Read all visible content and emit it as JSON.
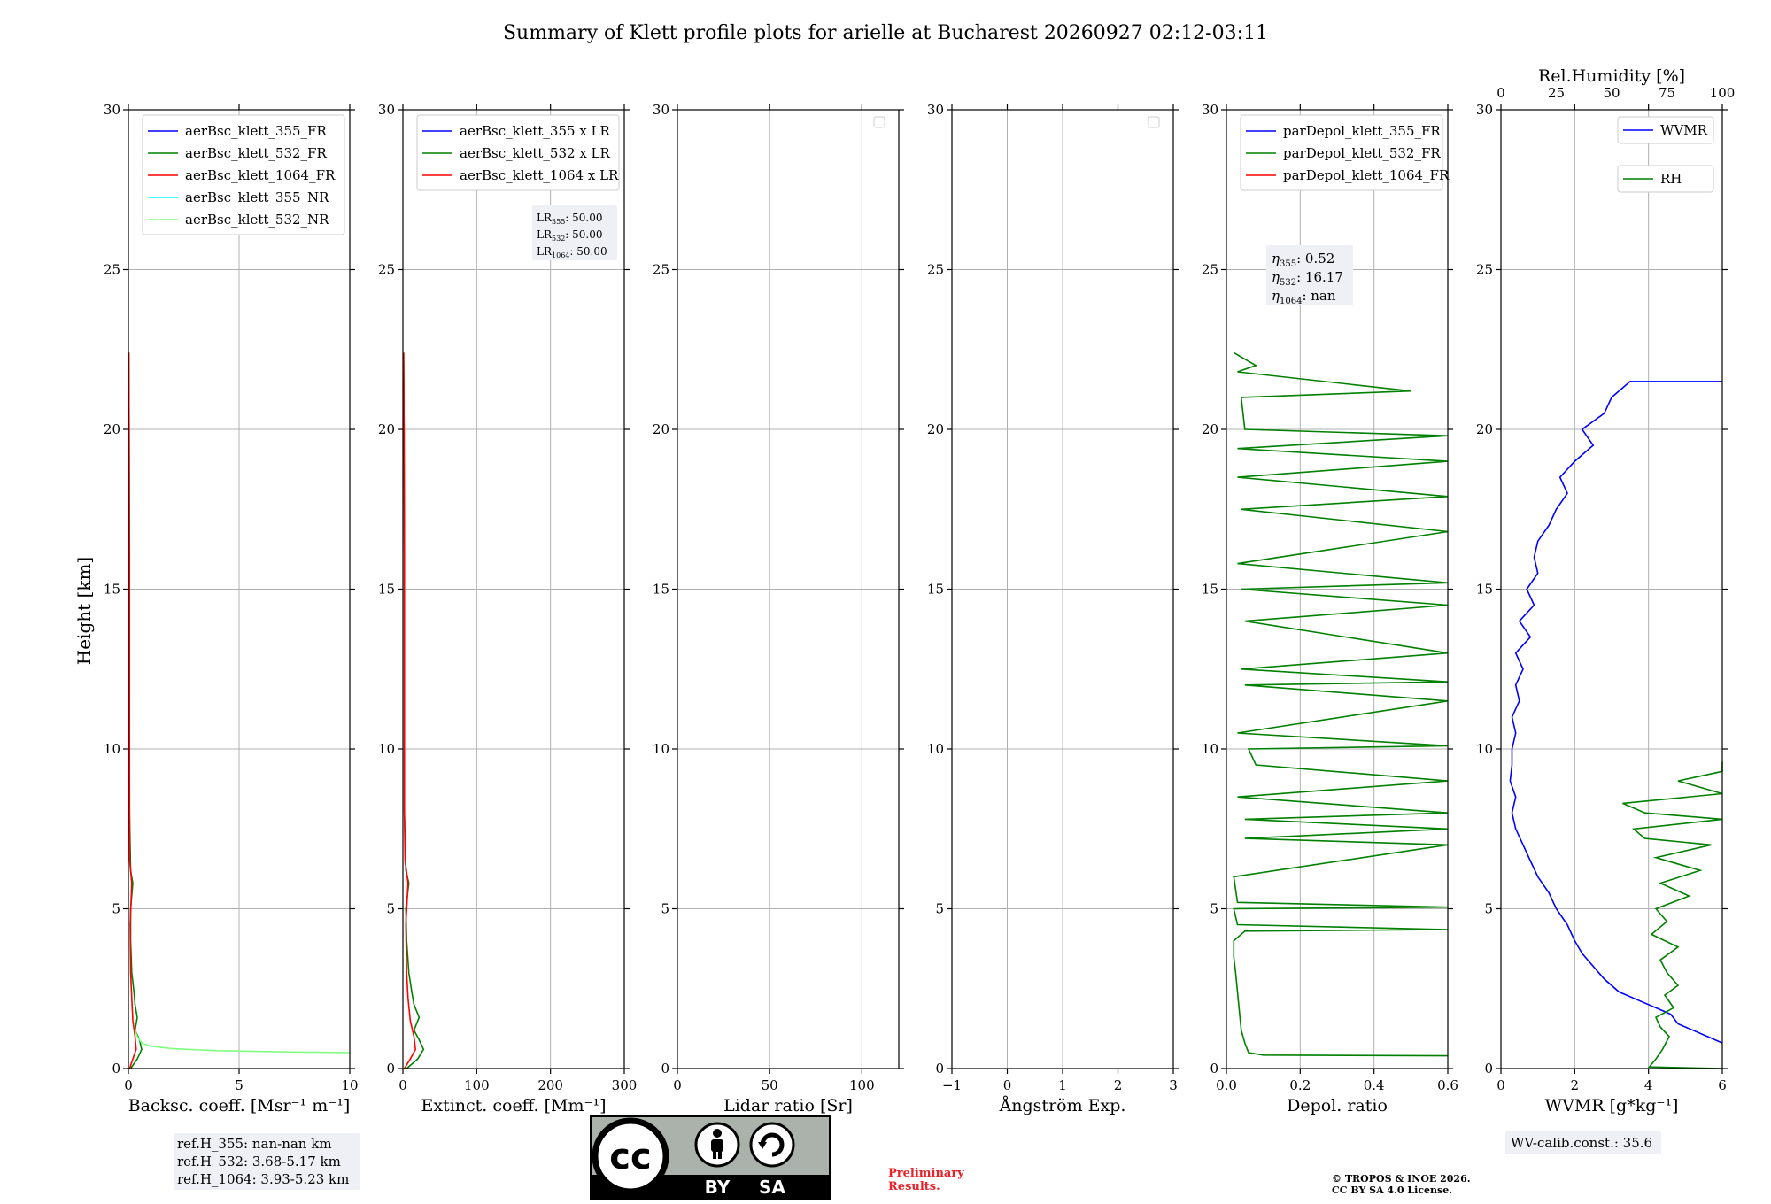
{
  "title": "Summary of Klett profile plots for arielle at Bucharest 20260927 02:12-03:11",
  "height_label": "Height [km]",
  "ref_heights": [
    "ref.H_355: nan-nan km",
    "ref.H_532: 3.68-5.17 km",
    "ref.H_1064: 3.93-5.23 km"
  ],
  "wv_calib": "WV-calib.const.: 35.6",
  "license_badge": {
    "by": "BY",
    "sa": "SA",
    "cc": "cc"
  },
  "preliminary": [
    "Preliminary",
    "Results."
  ],
  "copyright": [
    "© TROPOS & INOE 2026.",
    "CC BY SA 4.0 License."
  ],
  "colors": {
    "blue": "#0000ff",
    "green": "#008000",
    "red": "#ff0000",
    "cyan": "#00ffff",
    "lightgreen": "#80ff80",
    "grid": "#b0b0b0"
  },
  "chart_data": [
    {
      "type": "line",
      "xlabel": "Backsc. coeff. [Msr⁻¹ m⁻¹]",
      "ylabel": "Height [km]",
      "xlim": [
        0,
        10
      ],
      "ylim": [
        0,
        30
      ],
      "xticks": [
        0,
        5,
        10
      ],
      "yticks": [
        0,
        5,
        10,
        15,
        20,
        25,
        30
      ],
      "grid": true,
      "legend_position": "top-right",
      "series": [
        {
          "name": "aerBsc_klett_355_FR",
          "color": "#0000ff",
          "points": []
        },
        {
          "name": "aerBsc_klett_532_FR",
          "color": "#008000",
          "points": [
            [
              0.1,
              0
            ],
            [
              0.4,
              0.3
            ],
            [
              0.6,
              0.6
            ],
            [
              0.5,
              0.9
            ],
            [
              0.3,
              1.2
            ],
            [
              0.4,
              1.6
            ],
            [
              0.3,
              2.0
            ],
            [
              0.25,
              2.4
            ],
            [
              0.15,
              3.0
            ],
            [
              0.1,
              4.0
            ],
            [
              0.1,
              5.0
            ],
            [
              0.2,
              5.8
            ],
            [
              0.1,
              6.2
            ],
            [
              0.05,
              8
            ],
            [
              0.05,
              12
            ],
            [
              0.05,
              16
            ],
            [
              0.03,
              20
            ],
            [
              0.02,
              22.4
            ]
          ]
        },
        {
          "name": "aerBsc_klett_1064_FR",
          "color": "#ff0000",
          "points": [
            [
              0.05,
              0
            ],
            [
              0.2,
              0.3
            ],
            [
              0.35,
              0.6
            ],
            [
              0.3,
              1.0
            ],
            [
              0.2,
              1.5
            ],
            [
              0.15,
              2.2
            ],
            [
              0.1,
              3.0
            ],
            [
              0.08,
              4.5
            ],
            [
              0.15,
              5.8
            ],
            [
              0.06,
              6.5
            ],
            [
              0.05,
              8
            ],
            [
              0.04,
              12
            ],
            [
              0.04,
              16
            ],
            [
              0.03,
              20
            ],
            [
              0.02,
              22.4
            ]
          ]
        },
        {
          "name": "aerBsc_klett_355_NR",
          "color": "#00ffff",
          "points": []
        },
        {
          "name": "aerBsc_klett_532_NR",
          "color": "#80ff80",
          "points": [
            [
              10,
              0.5
            ],
            [
              7,
              0.52
            ],
            [
              4,
              0.56
            ],
            [
              2,
              0.62
            ],
            [
              1,
              0.7
            ],
            [
              0.6,
              0.8
            ],
            [
              0.4,
              1.0
            ],
            [
              0.3,
              1.2
            ]
          ]
        }
      ],
      "annotation": []
    },
    {
      "type": "line",
      "xlabel": "Extinct. coeff. [Mm⁻¹]",
      "xlim": [
        0,
        300
      ],
      "ylim": [
        0,
        30
      ],
      "xticks": [
        0,
        100,
        200,
        300
      ],
      "yticks": [
        0,
        5,
        10,
        15,
        20,
        25,
        30
      ],
      "grid": true,
      "legend_position": "top-right",
      "series": [
        {
          "name": "aerBsc_klett_355 x LR",
          "color": "#0000ff",
          "points": []
        },
        {
          "name": "aerBsc_klett_532 x LR",
          "color": "#008000",
          "points": [
            [
              5,
              0
            ],
            [
              20,
              0.3
            ],
            [
              28,
              0.6
            ],
            [
              22,
              0.9
            ],
            [
              15,
              1.2
            ],
            [
              22,
              1.6
            ],
            [
              15,
              2.0
            ],
            [
              12,
              2.4
            ],
            [
              8,
              3.0
            ],
            [
              5,
              4.0
            ],
            [
              4,
              5.0
            ],
            [
              8,
              5.8
            ],
            [
              4,
              6.2
            ],
            [
              2,
              8
            ],
            [
              2,
              12
            ],
            [
              2,
              16
            ],
            [
              1.5,
              20
            ],
            [
              1,
              22.4
            ]
          ]
        },
        {
          "name": "aerBsc_klett_1064 x LR",
          "color": "#ff0000",
          "points": [
            [
              2,
              0
            ],
            [
              10,
              0.3
            ],
            [
              17,
              0.6
            ],
            [
              15,
              1.0
            ],
            [
              10,
              1.5
            ],
            [
              7,
              2.2
            ],
            [
              5,
              3.0
            ],
            [
              4,
              4.5
            ],
            [
              7,
              5.8
            ],
            [
              3,
              6.5
            ],
            [
              2,
              8
            ],
            [
              2,
              12
            ],
            [
              2,
              16
            ],
            [
              1.5,
              20
            ],
            [
              1,
              22.4
            ]
          ]
        }
      ],
      "annotation": {
        "lr355": "50.00",
        "lr532": "50.00",
        "lr1064": "50.00"
      }
    },
    {
      "type": "line",
      "xlabel": "Lidar ratio [Sr]",
      "xlim": [
        0,
        120
      ],
      "ylim": [
        0,
        30
      ],
      "xticks": [
        0,
        50,
        100
      ],
      "yticks": [
        0,
        5,
        10,
        15,
        20,
        25,
        30
      ],
      "grid": true,
      "legend_position": "top-right",
      "series": []
    },
    {
      "type": "line",
      "xlabel": "Ångström Exp.",
      "xlim": [
        -1,
        3
      ],
      "ylim": [
        0,
        30
      ],
      "xticks": [
        -1,
        0,
        1,
        2,
        3
      ],
      "yticks": [
        0,
        5,
        10,
        15,
        20,
        25,
        30
      ],
      "grid": true,
      "legend_position": "top-right",
      "series": []
    },
    {
      "type": "line",
      "xlabel": "Depol. ratio",
      "xlim": [
        0,
        0.6
      ],
      "ylim": [
        0,
        30
      ],
      "xticks": [
        0.0,
        0.2,
        0.4,
        0.6
      ],
      "yticks": [
        0,
        5,
        10,
        15,
        20,
        25,
        30
      ],
      "grid": true,
      "legend_position": "top-right",
      "series": [
        {
          "name": "parDepol_klett_355_FR",
          "color": "#0000ff",
          "points": []
        },
        {
          "name": "parDepol_klett_532_FR",
          "color": "#008000",
          "points": [
            [
              0.6,
              0.4
            ],
            [
              0.1,
              0.42
            ],
            [
              0.06,
              0.5
            ],
            [
              0.05,
              0.8
            ],
            [
              0.04,
              1.2
            ],
            [
              0.035,
              1.8
            ],
            [
              0.03,
              2.4
            ],
            [
              0.025,
              3.0
            ],
            [
              0.02,
              3.5
            ],
            [
              0.02,
              4.0
            ],
            [
              0.05,
              4.3
            ],
            [
              0.6,
              4.35
            ],
            [
              0.03,
              4.5
            ],
            [
              0.02,
              5.0
            ],
            [
              0.6,
              5.05
            ],
            [
              0.03,
              5.2
            ],
            [
              0.02,
              6.0
            ],
            [
              0.6,
              7.0
            ],
            [
              0.05,
              7.2
            ],
            [
              0.6,
              7.5
            ],
            [
              0.05,
              7.8
            ],
            [
              0.6,
              8.0
            ],
            [
              0.03,
              8.5
            ],
            [
              0.6,
              9.0
            ],
            [
              0.08,
              9.5
            ],
            [
              0.06,
              10.0
            ],
            [
              0.6,
              10.1
            ],
            [
              0.03,
              10.5
            ],
            [
              0.6,
              11.5
            ],
            [
              0.05,
              12.0
            ],
            [
              0.6,
              12.1
            ],
            [
              0.04,
              12.5
            ],
            [
              0.6,
              13.0
            ],
            [
              0.05,
              14.0
            ],
            [
              0.6,
              14.5
            ],
            [
              0.04,
              15.0
            ],
            [
              0.6,
              15.2
            ],
            [
              0.03,
              15.8
            ],
            [
              0.6,
              16.8
            ],
            [
              0.04,
              17.5
            ],
            [
              0.6,
              17.9
            ],
            [
              0.03,
              18.5
            ],
            [
              0.6,
              19.0
            ],
            [
              0.03,
              19.4
            ],
            [
              0.6,
              19.8
            ],
            [
              0.05,
              20.0
            ],
            [
              0.04,
              21.0
            ],
            [
              0.5,
              21.2
            ],
            [
              0.03,
              21.8
            ],
            [
              0.08,
              22.0
            ],
            [
              0.02,
              22.4
            ]
          ]
        },
        {
          "name": "parDepol_klett_1064_FR",
          "color": "#ff0000",
          "points": []
        }
      ],
      "annotation": {
        "eta355": "0.52",
        "eta532": "16.17",
        "eta1064": "nan"
      }
    },
    {
      "type": "line",
      "xlabel": "WVMR [g*kg⁻¹]",
      "x2label": "Rel.Humidity [%]",
      "xlim": [
        0,
        6
      ],
      "x2lim": [
        0,
        100
      ],
      "ylim": [
        0,
        30
      ],
      "xticks": [
        0,
        2,
        4,
        6
      ],
      "x2ticks": [
        0,
        25,
        50,
        75,
        100
      ],
      "yticks": [
        0,
        5,
        10,
        15,
        20,
        25,
        30
      ],
      "grid": true,
      "legend_position": "top-right",
      "series": [
        {
          "name": "WVMR",
          "color": "#0000ff",
          "axis": "bottom",
          "points": [
            [
              6,
              0.8
            ],
            [
              5.6,
              1.0
            ],
            [
              5.2,
              1.2
            ],
            [
              4.8,
              1.4
            ],
            [
              4.6,
              1.7
            ],
            [
              4.2,
              1.9
            ],
            [
              3.8,
              2.1
            ],
            [
              3.2,
              2.4
            ],
            [
              2.8,
              2.8
            ],
            [
              2.5,
              3.2
            ],
            [
              2.2,
              3.6
            ],
            [
              2.0,
              4.0
            ],
            [
              1.8,
              4.5
            ],
            [
              1.5,
              5.0
            ],
            [
              1.3,
              5.5
            ],
            [
              1.0,
              6.0
            ],
            [
              0.8,
              6.5
            ],
            [
              0.6,
              7.0
            ],
            [
              0.4,
              7.5
            ],
            [
              0.3,
              8.0
            ],
            [
              0.4,
              8.5
            ],
            [
              0.25,
              9.0
            ],
            [
              0.3,
              9.5
            ],
            [
              0.3,
              10.0
            ],
            [
              0.4,
              10.5
            ],
            [
              0.3,
              11.0
            ],
            [
              0.5,
              11.5
            ],
            [
              0.4,
              12.0
            ],
            [
              0.6,
              12.5
            ],
            [
              0.4,
              13.0
            ],
            [
              0.8,
              13.5
            ],
            [
              0.5,
              14.0
            ],
            [
              0.9,
              14.5
            ],
            [
              0.7,
              15.0
            ],
            [
              1.0,
              15.5
            ],
            [
              0.9,
              16.0
            ],
            [
              1.0,
              16.5
            ],
            [
              1.3,
              17.0
            ],
            [
              1.5,
              17.5
            ],
            [
              1.8,
              18.0
            ],
            [
              1.6,
              18.5
            ],
            [
              2.0,
              19.0
            ],
            [
              2.5,
              19.5
            ],
            [
              2.2,
              20.0
            ],
            [
              2.8,
              20.5
            ],
            [
              3.0,
              21.0
            ],
            [
              3.5,
              21.5
            ],
            [
              6.0,
              21.5
            ]
          ]
        },
        {
          "name": "RH",
          "color": "#008000",
          "axis": "top",
          "points": [
            [
              100,
              0.0
            ],
            [
              67,
              0.05
            ],
            [
              70,
              0.3
            ],
            [
              73,
              0.6
            ],
            [
              76,
              1.0
            ],
            [
              72,
              1.3
            ],
            [
              70,
              1.6
            ],
            [
              78,
              1.9
            ],
            [
              74,
              2.3
            ],
            [
              80,
              2.6
            ],
            [
              75,
              3.0
            ],
            [
              72,
              3.4
            ],
            [
              80,
              3.8
            ],
            [
              68,
              4.2
            ],
            [
              75,
              4.6
            ],
            [
              70,
              5.0
            ],
            [
              85,
              5.4
            ],
            [
              72,
              5.8
            ],
            [
              90,
              6.2
            ],
            [
              70,
              6.6
            ],
            [
              95,
              7.0
            ],
            [
              65,
              7.2
            ],
            [
              60,
              7.5
            ],
            [
              100,
              7.8
            ],
            [
              65,
              8.0
            ],
            [
              55,
              8.3
            ],
            [
              100,
              8.6
            ],
            [
              80,
              9.0
            ],
            [
              100,
              9.3
            ],
            [
              100,
              9.6
            ]
          ]
        }
      ]
    }
  ]
}
